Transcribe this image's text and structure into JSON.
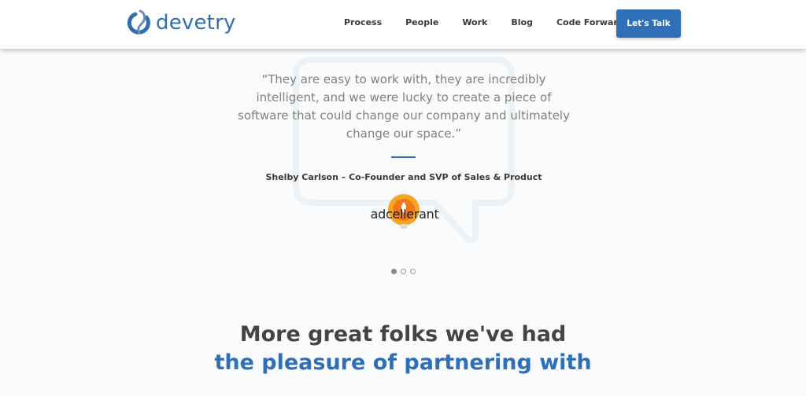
{
  "header": {
    "logo_text": "devetry",
    "nav": [
      "Process",
      "People",
      "Work",
      "Blog",
      "Code Forward"
    ],
    "cta_label": "Let's Talk"
  },
  "testimonial": {
    "quote": "“They are easy to work with, they are incredibly intelligent, and we were lucky to create a piece of software that could change our company and ultimately change our space.”",
    "author": "Shelby Carlson – Co-Founder and SVP of Sales & Product",
    "client_logo_text": "adcellerant",
    "slides_total": 3,
    "active_slide": 1
  },
  "partners": {
    "headline_line1": "More great folks we've had",
    "headline_line2": "the pleasure of partnering with"
  },
  "colors": {
    "brand_blue": "#2e6fb8",
    "text_dark": "#3a3a3a",
    "text_muted": "#808080",
    "client_orange": "#f07a1a"
  }
}
